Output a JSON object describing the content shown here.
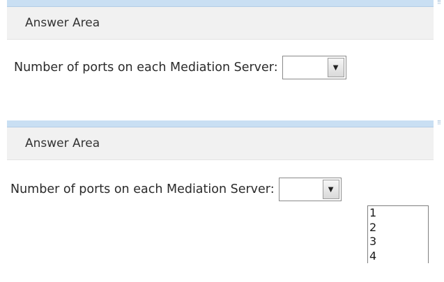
{
  "top_panel": {
    "header_title": "Answer Area",
    "question_label": "Number of ports on each Mediation Server:",
    "select_value": ""
  },
  "bottom_panel": {
    "header_title": "Answer Area",
    "question_label": "Number of ports on each Mediation Server:",
    "select_value": "",
    "options": [
      "1",
      "2",
      "3",
      "4"
    ]
  },
  "icons": {
    "dropdown_arrow": "chevron-down-icon",
    "panel_grip": "grip-icon"
  }
}
